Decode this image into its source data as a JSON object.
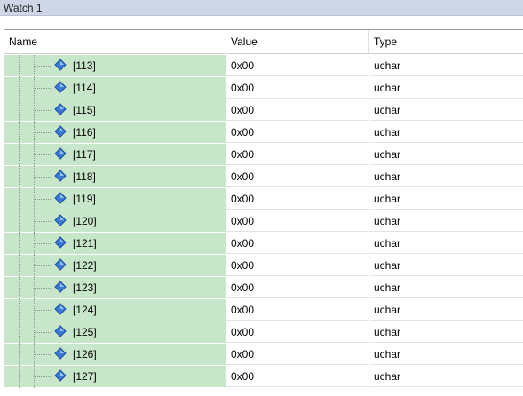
{
  "window": {
    "title": "Watch 1"
  },
  "columns": {
    "name": "Name",
    "value": "Value",
    "type": "Type"
  },
  "rows": [
    {
      "name": "[113]",
      "value": "0x00",
      "type": "uchar"
    },
    {
      "name": "[114]",
      "value": "0x00",
      "type": "uchar"
    },
    {
      "name": "[115]",
      "value": "0x00",
      "type": "uchar"
    },
    {
      "name": "[116]",
      "value": "0x00",
      "type": "uchar"
    },
    {
      "name": "[117]",
      "value": "0x00",
      "type": "uchar"
    },
    {
      "name": "[118]",
      "value": "0x00",
      "type": "uchar"
    },
    {
      "name": "[119]",
      "value": "0x00",
      "type": "uchar"
    },
    {
      "name": "[120]",
      "value": "0x00",
      "type": "uchar"
    },
    {
      "name": "[121]",
      "value": "0x00",
      "type": "uchar"
    },
    {
      "name": "[122]",
      "value": "0x00",
      "type": "uchar"
    },
    {
      "name": "[123]",
      "value": "0x00",
      "type": "uchar"
    },
    {
      "name": "[124]",
      "value": "0x00",
      "type": "uchar"
    },
    {
      "name": "[125]",
      "value": "0x00",
      "type": "uchar"
    },
    {
      "name": "[126]",
      "value": "0x00",
      "type": "uchar"
    },
    {
      "name": "[127]",
      "value": "0x00",
      "type": "uchar"
    }
  ],
  "icons": {
    "member": "member-diamond-icon"
  },
  "colors": {
    "name_column_bg": "#c8e6c9",
    "icon_blue": "#3a7bd5"
  }
}
